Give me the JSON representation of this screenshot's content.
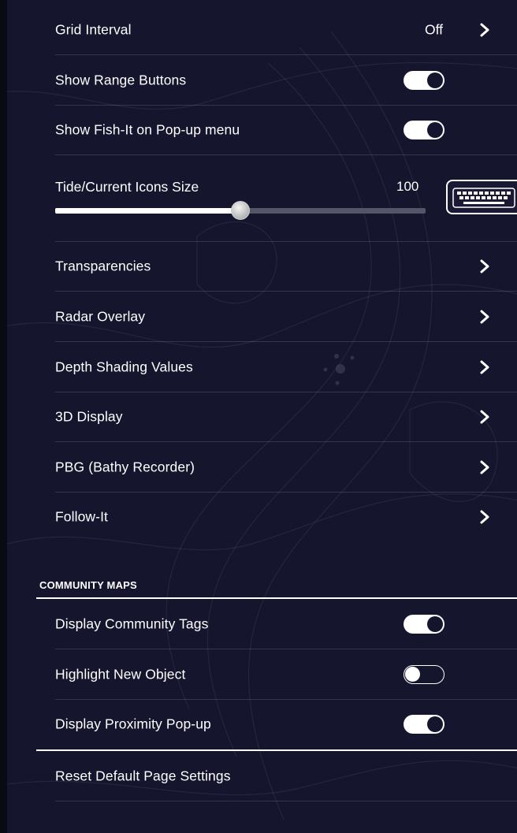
{
  "settings": {
    "grid_interval": {
      "label": "Grid Interval",
      "value": "Off"
    },
    "show_range_buttons": {
      "label": "Show Range Buttons",
      "enabled": true
    },
    "show_fish_it": {
      "label": "Show Fish-It on Pop-up menu",
      "enabled": true
    },
    "tide_icons_size": {
      "label": "Tide/Current Icons Size",
      "value": "100",
      "slider_fraction": 0.5
    },
    "transparencies": {
      "label": "Transparencies"
    },
    "radar_overlay": {
      "label": "Radar Overlay"
    },
    "depth_shading": {
      "label": "Depth Shading Values"
    },
    "display_3d": {
      "label": "3D Display"
    },
    "pbg": {
      "label": "PBG (Bathy Recorder)"
    },
    "follow_it": {
      "label": "Follow-It"
    }
  },
  "community_maps": {
    "header": "COMMUNITY MAPS",
    "display_tags": {
      "label": "Display Community Tags",
      "enabled": true
    },
    "highlight_new": {
      "label": "Highlight New Object",
      "enabled": false
    },
    "proximity_popup": {
      "label": "Display Proximity Pop-up",
      "enabled": true
    }
  },
  "reset": {
    "label": "Reset Default Page Settings"
  },
  "icons": {
    "chevron": "chevron-right-icon",
    "keyboard": "keyboard-icon"
  },
  "colors": {
    "background": "#15152e",
    "text": "#ffffff",
    "accent": "#ffffff"
  }
}
